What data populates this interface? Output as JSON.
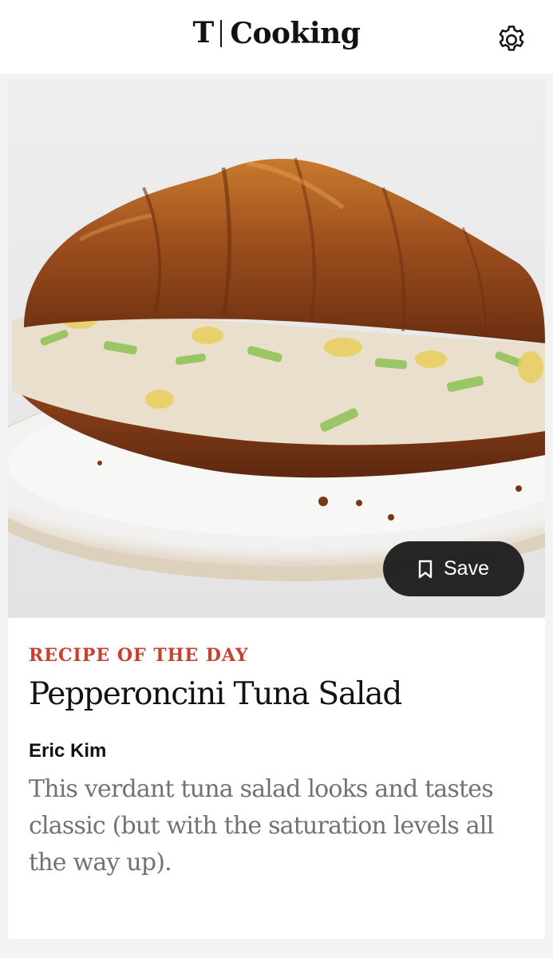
{
  "header": {
    "brand_mark": "T",
    "brand_name": "Cooking",
    "settings_icon": "gear-icon"
  },
  "recipe": {
    "kicker": "RECIPE OF THE DAY",
    "title": "Pepperoncini Tuna Salad",
    "author": "Eric Kim",
    "description": "This verdant tuna salad looks and tastes classic (but with the saturation levels all the way up).",
    "image_icon": "croissant-sandwich-photo",
    "save_icon": "bookmark-icon",
    "save_label": "Save"
  },
  "colors": {
    "kicker": "#c8402f",
    "text": "#121212",
    "muted": "#727272",
    "save_button_bg": "#161616"
  }
}
